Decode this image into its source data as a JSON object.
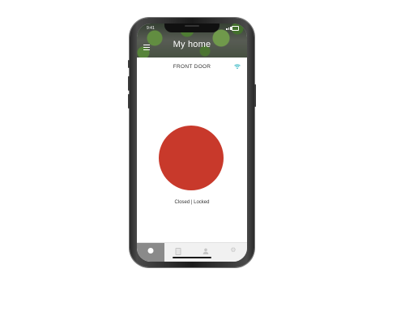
{
  "status_bar": {
    "time": "9:41"
  },
  "header": {
    "title": "My home",
    "menu_icon": "hamburger-menu-icon"
  },
  "device": {
    "name": "FRONT DOOR",
    "connection_icon": "wifi-icon",
    "lock_state_color": "#c8392b",
    "status": "Closed | Locked"
  },
  "tabbar": {
    "tabs": [
      {
        "icon": "lock-circle-icon",
        "active": true
      },
      {
        "icon": "log-list-icon",
        "active": false
      },
      {
        "icon": "users-icon",
        "active": false
      },
      {
        "icon": "gear-icon",
        "active": false
      }
    ]
  },
  "colors": {
    "accent_wifi": "#2bb3c0",
    "active_tab": "#8a8a8a"
  }
}
